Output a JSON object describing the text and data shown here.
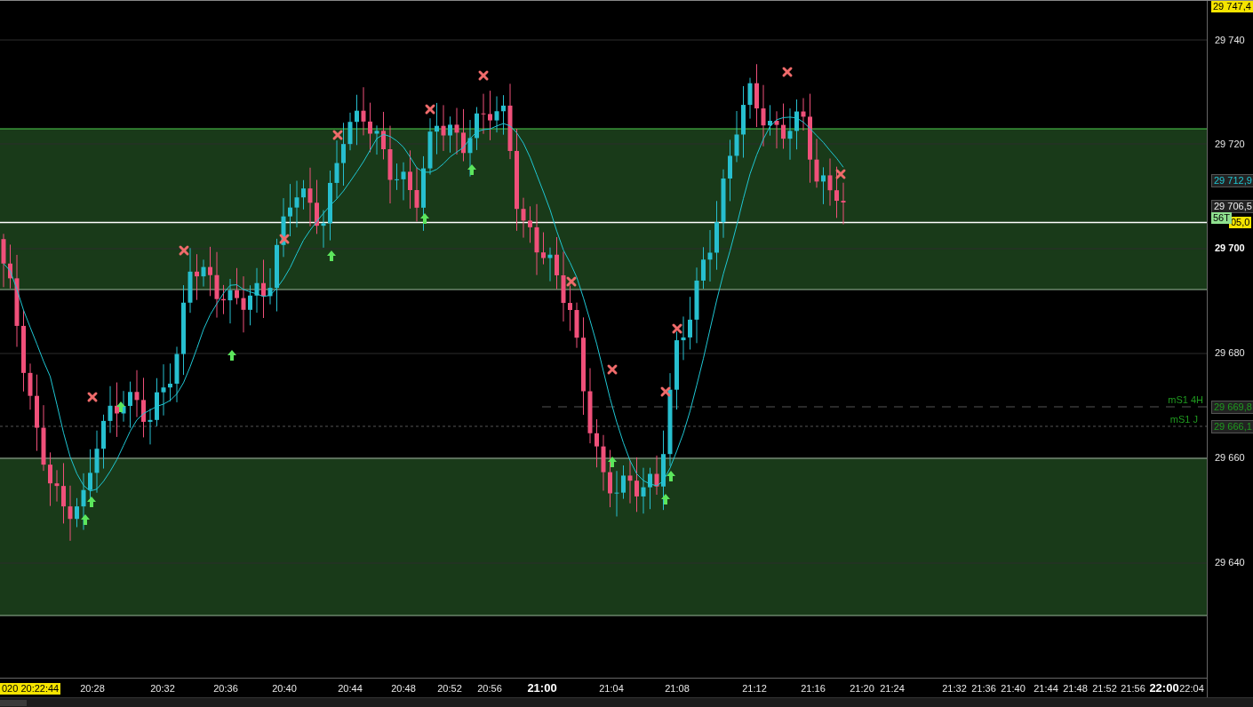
{
  "chart": {
    "kind": "candlestick",
    "level_lines": [
      {
        "label": "mS1 4H"
      },
      {
        "label": "mS1 J"
      }
    ]
  },
  "price_axis": {
    "labels": [
      {
        "text": "29 747,4",
        "kind": "yellow-box"
      },
      {
        "text": "29 740",
        "kind": "tick"
      },
      {
        "text": "29 720",
        "kind": "tick"
      },
      {
        "text": "29 712,9",
        "kind": "cyan-box"
      },
      {
        "text": "29 706,5",
        "kind": "grey-box"
      },
      {
        "text": "56T",
        "kind": "green-badge"
      },
      {
        "text": "05,0",
        "kind": "yellow-box"
      },
      {
        "text": "29 700",
        "kind": "tick-bold"
      },
      {
        "text": "29 680",
        "kind": "tick"
      },
      {
        "text": "29 669,8",
        "kind": "green-box"
      },
      {
        "text": "29 666,1",
        "kind": "green-box"
      },
      {
        "text": "29 660",
        "kind": "tick"
      },
      {
        "text": "29 640",
        "kind": "tick"
      }
    ]
  },
  "time_axis": {
    "labels": [
      {
        "text": "020 20:22:44",
        "kind": "cursor"
      },
      {
        "text": "20:28",
        "kind": "tick"
      },
      {
        "text": "20:32",
        "kind": "tick"
      },
      {
        "text": "20:36",
        "kind": "tick"
      },
      {
        "text": "20:40",
        "kind": "tick"
      },
      {
        "text": "20:44",
        "kind": "tick"
      },
      {
        "text": "20:48",
        "kind": "tick"
      },
      {
        "text": "20:52",
        "kind": "tick"
      },
      {
        "text": "20:56",
        "kind": "tick"
      },
      {
        "text": "21:00",
        "kind": "tick-bold"
      },
      {
        "text": "21:04",
        "kind": "tick"
      },
      {
        "text": "21:08",
        "kind": "tick"
      },
      {
        "text": "21:12",
        "kind": "tick"
      },
      {
        "text": "21:16",
        "kind": "tick"
      },
      {
        "text": "21:20",
        "kind": "tick"
      },
      {
        "text": "21:24",
        "kind": "tick"
      },
      {
        "text": "21:32",
        "kind": "tick"
      },
      {
        "text": "21:36",
        "kind": "tick"
      },
      {
        "text": "21:40",
        "kind": "tick"
      },
      {
        "text": "21:44",
        "kind": "tick"
      },
      {
        "text": "21:48",
        "kind": "tick"
      },
      {
        "text": "21:52",
        "kind": "tick"
      },
      {
        "text": "21:56",
        "kind": "tick"
      },
      {
        "text": "22:00",
        "kind": "tick-bold"
      },
      {
        "text": "22:04",
        "kind": "tick"
      }
    ]
  }
}
